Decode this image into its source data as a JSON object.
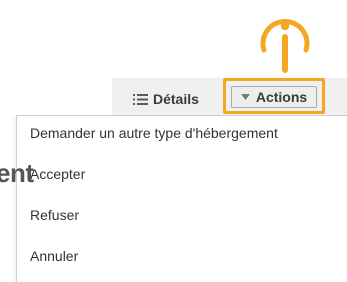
{
  "page_fragment": {
    "text": "ent"
  },
  "toolbar": {
    "details_label": "Détails",
    "details_icon": "list-icon",
    "actions_label": "Actions",
    "actions_icon": "caret-down-icon"
  },
  "callout": {
    "icon": "info-icon",
    "color": "#f5a623"
  },
  "menu": {
    "items": [
      {
        "label": "Demander un autre type d'hébergement"
      },
      {
        "label": "Accepter"
      },
      {
        "label": "Refuser"
      },
      {
        "label": "Annuler"
      }
    ]
  },
  "colors": {
    "accent": "#f5a623",
    "toolbar_bg": "#f0f0f0",
    "menu_text": "#333333"
  }
}
